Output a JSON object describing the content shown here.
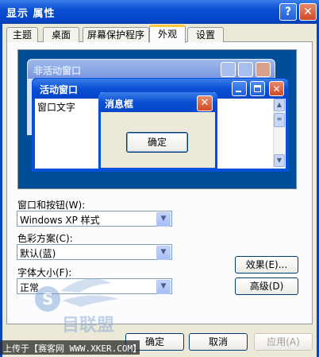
{
  "window": {
    "title": "显示 属性",
    "help_glyph": "?",
    "close_glyph": "✕"
  },
  "tabs": [
    {
      "label": "主题",
      "active": false
    },
    {
      "label": "桌面",
      "active": false
    },
    {
      "label": "屏幕保护程序",
      "active": false
    },
    {
      "label": "外观",
      "active": true
    },
    {
      "label": "设置",
      "active": false
    }
  ],
  "preview": {
    "inactive_window_title": "非活动窗口",
    "active_window_title": "活动窗口",
    "window_text": "窗口文字",
    "message_box_title": "消息框",
    "message_box_ok": "确定"
  },
  "settings": {
    "windows_buttons_label": "窗口和按钮(W):",
    "windows_buttons_value": "Windows XP 样式",
    "color_scheme_label": "色彩方案(C):",
    "color_scheme_value": "默认(蓝)",
    "font_size_label": "字体大小(F):",
    "font_size_value": "正常"
  },
  "side_buttons": {
    "effects": "效果(E)...",
    "advanced": "高级(D)"
  },
  "bottom_buttons": {
    "ok": "确定",
    "cancel": "取消",
    "apply": "应用(A)",
    "apply_enabled": false
  },
  "watermark": {
    "text": "上传于【赛客网 WWW.XKER.COM】",
    "logo_text": "目联盟"
  },
  "colors": {
    "titlebar_blue": "#0a4fd4",
    "close_red": "#cf4a24",
    "dialog_bg": "#ece9d8",
    "preview_desktop": "#004e98",
    "active_tab_accent": "#ffc83c"
  }
}
